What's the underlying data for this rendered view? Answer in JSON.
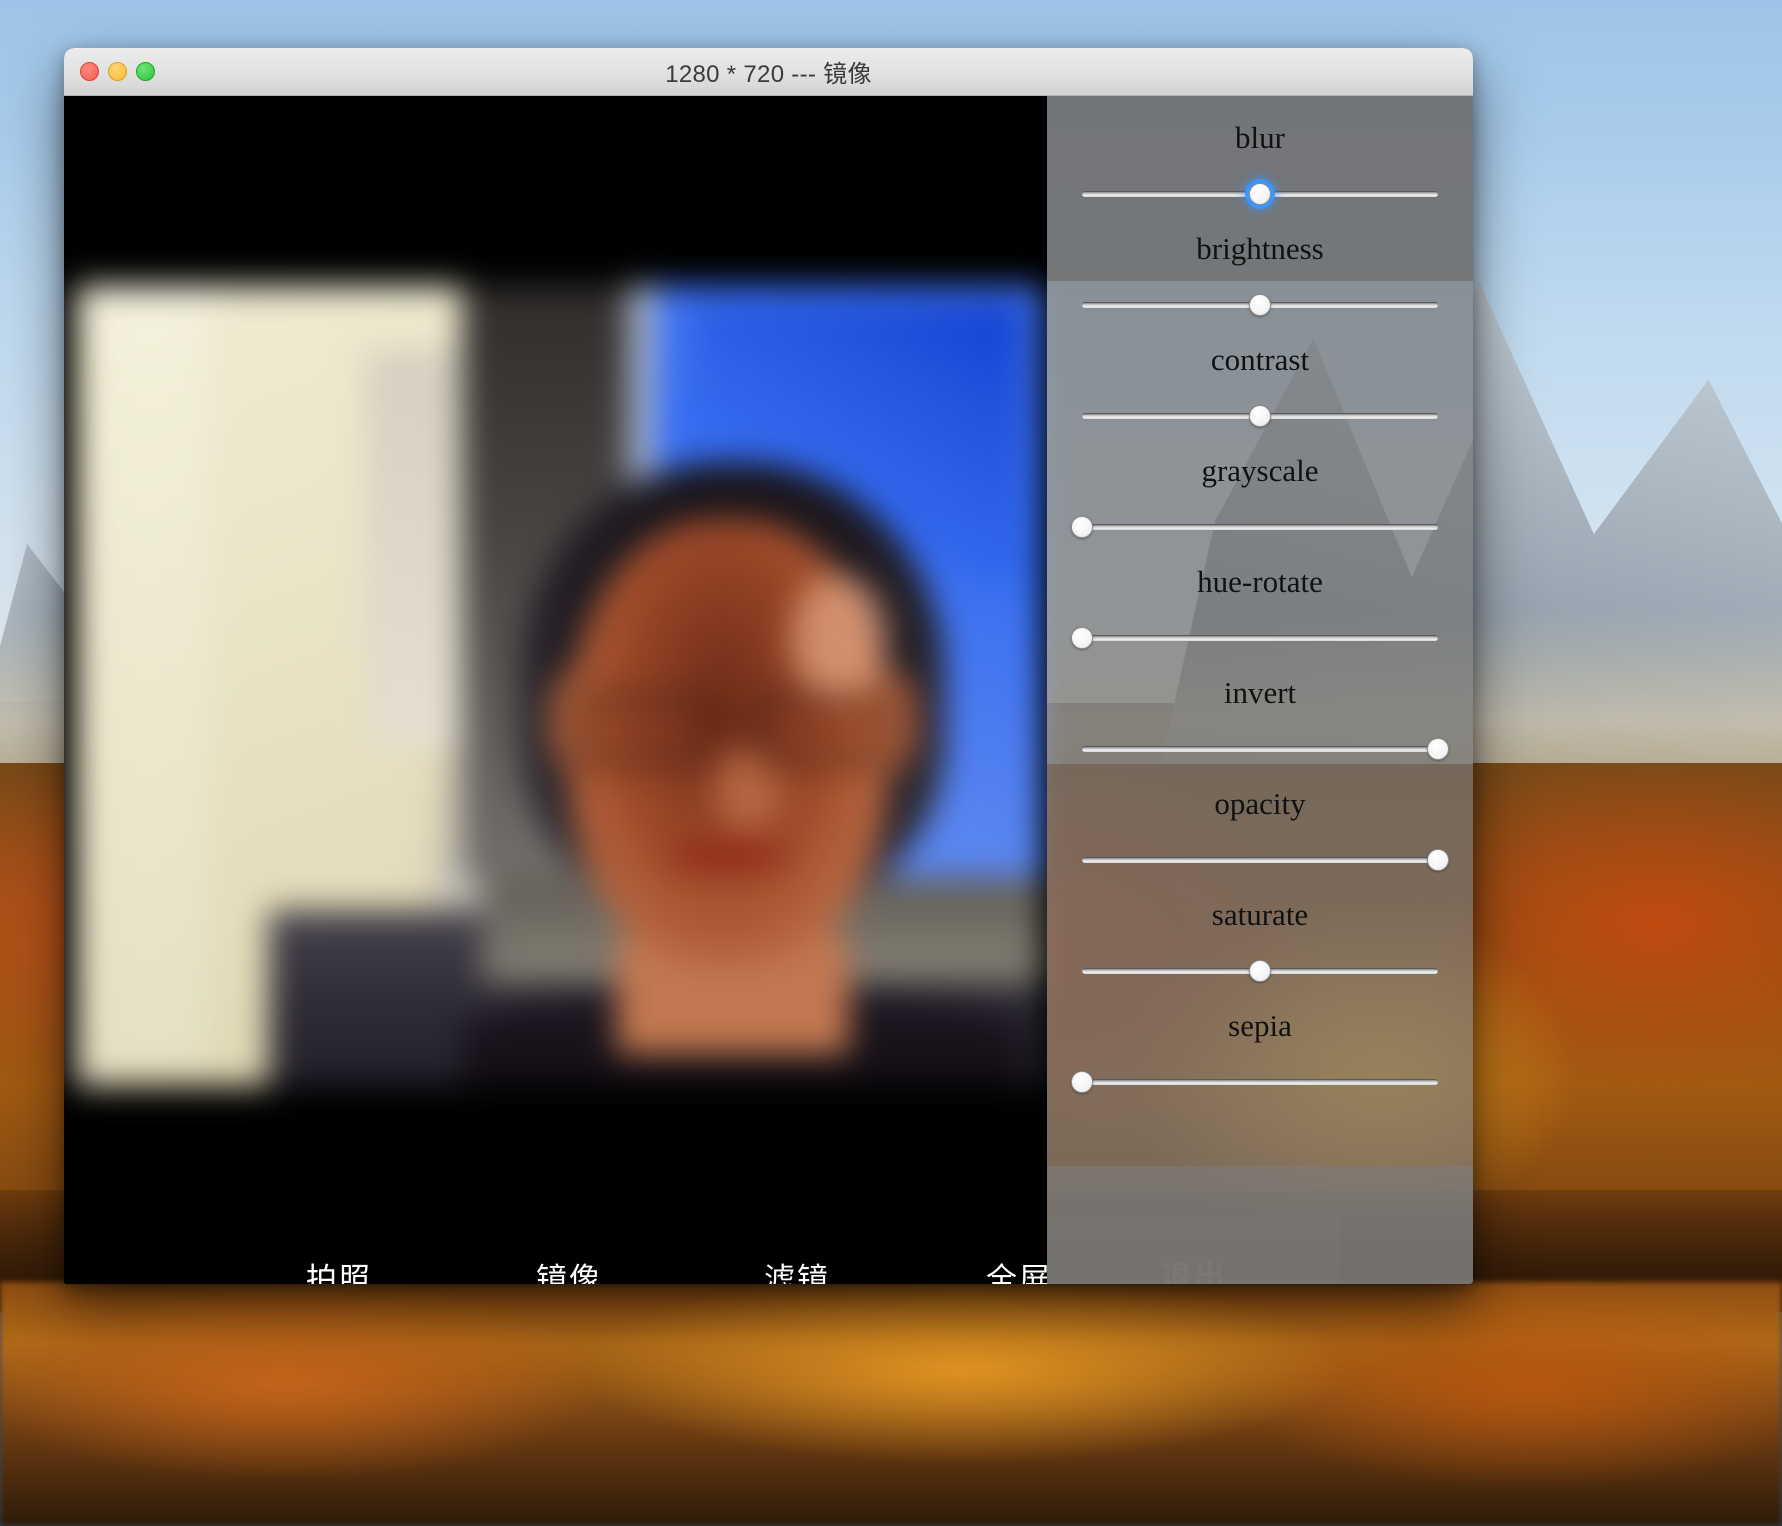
{
  "window": {
    "title": "1280 * 720 --- 镜像",
    "traffic_lights": [
      {
        "name": "close",
        "color": "#f4594f"
      },
      {
        "name": "minimize",
        "color": "#f9bd2e"
      },
      {
        "name": "maximize",
        "color": "#2ac734"
      }
    ]
  },
  "controls": {
    "capture_label": "拍照",
    "mirror_label": "镜像",
    "filter_label": "滤镜",
    "fullscreen_label": "全屏",
    "exit_label": "退出"
  },
  "filter_panel": {
    "sliders": [
      {
        "name": "blur",
        "label": "blur",
        "value": 50,
        "min": 0,
        "max": 100,
        "focused": true
      },
      {
        "name": "brightness",
        "label": "brightness",
        "value": 50,
        "min": 0,
        "max": 100,
        "focused": false
      },
      {
        "name": "contrast",
        "label": "contrast",
        "value": 50,
        "min": 0,
        "max": 100,
        "focused": false
      },
      {
        "name": "grayscale",
        "label": "grayscale",
        "value": 0,
        "min": 0,
        "max": 100,
        "focused": false
      },
      {
        "name": "hue-rotate",
        "label": "hue-rotate",
        "value": 0,
        "min": 0,
        "max": 100,
        "focused": false
      },
      {
        "name": "invert",
        "label": "invert",
        "value": 100,
        "min": 0,
        "max": 100,
        "focused": false
      },
      {
        "name": "opacity",
        "label": "opacity",
        "value": 100,
        "min": 0,
        "max": 100,
        "focused": false
      },
      {
        "name": "saturate",
        "label": "saturate",
        "value": 50,
        "min": 0,
        "max": 100,
        "focused": false
      },
      {
        "name": "sepia",
        "label": "sepia",
        "value": 0,
        "min": 0,
        "max": 100,
        "focused": false
      }
    ],
    "accent_color": "#3a96ff",
    "panel_background": "rgba(255,255,255,0.42)"
  },
  "video": {
    "state": "live-preview",
    "applied_effects": "blur + invert"
  }
}
